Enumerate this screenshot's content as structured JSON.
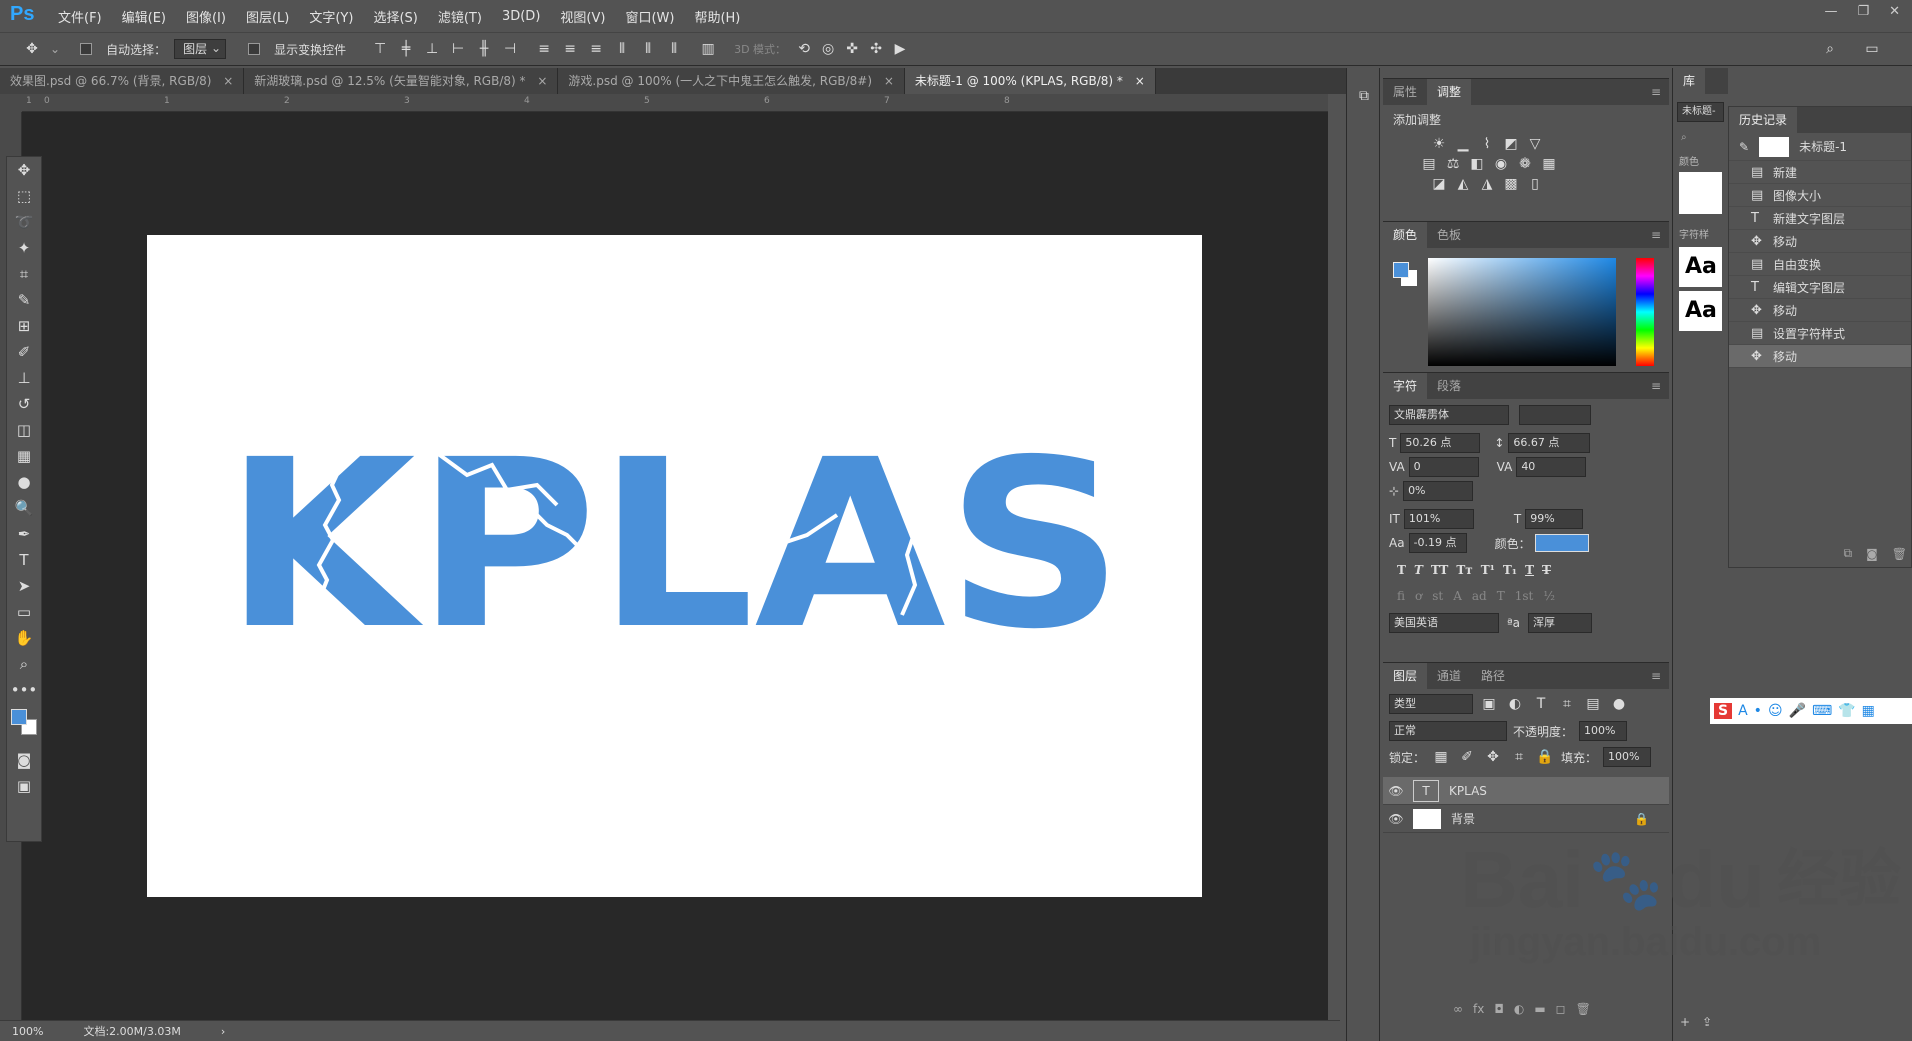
{
  "app": {
    "logo": "Ps"
  },
  "menu": [
    "文件(F)",
    "编辑(E)",
    "图像(I)",
    "图层(L)",
    "文字(Y)",
    "选择(S)",
    "滤镜(T)",
    "3D(D)",
    "视图(V)",
    "窗口(W)",
    "帮助(H)"
  ],
  "options": {
    "auto_select": "自动选择：",
    "layer_dd": "图层",
    "show_transform": "显示变换控件",
    "mode3d": "3D 模式："
  },
  "tabs": [
    "效果图.psd @ 66.7% (背景, RGB/8)",
    "新湖玻璃.psd @ 12.5% (矢量智能对象, RGB/8) *",
    "游戏.psd @ 100% (一人之下中鬼王怎么触发, RGB/8#)",
    "未标题-1 @ 100% (KPLAS, RGB/8) *"
  ],
  "ruler": [
    "1",
    "0",
    "1",
    "2",
    "3",
    "4",
    "5",
    "6",
    "7",
    "8"
  ],
  "canvas_text": "KPLAS",
  "text_color": "#4a90d9",
  "status": {
    "zoom": "100%",
    "doc": "文档:2.00M/3.03M"
  },
  "adjust": {
    "tab1": "属性",
    "tab2": "调整",
    "title": "添加调整"
  },
  "color": {
    "tab1": "颜色",
    "tab2": "色板",
    "fg": "#4a90d9"
  },
  "char": {
    "tab1": "字符",
    "tab2": "段落",
    "font": "文鼎霹雳体",
    "size": "50.26 点",
    "leading": "66.67 点",
    "kerning": "0",
    "tracking": "40",
    "scale": "0%",
    "vscale": "101%",
    "hscale": "99%",
    "baseline": "-0.19 点",
    "color_label": "颜色：",
    "lang": "美国英语",
    "aa": "浑厚",
    "aa_label": "ªa"
  },
  "layers": {
    "tab1": "图层",
    "tab2": "通道",
    "tab3": "路径",
    "filter": "类型",
    "blend": "正常",
    "opacity_label": "不透明度：",
    "opacity": "100%",
    "lock_label": "锁定：",
    "fill_label": "填充：",
    "fill": "100%",
    "items": [
      {
        "name": "KPLAS"
      },
      {
        "name": "背景"
      }
    ]
  },
  "lib": {
    "tab": "库",
    "untitled": "未标题-",
    "color_label": "颜色",
    "char_label": "字符样",
    "aa": "Aa"
  },
  "history": {
    "tab": "历史记录",
    "snapshot": "未标题-1",
    "items": [
      "新建",
      "图像大小",
      "新建文字图层",
      "移动",
      "自由变换",
      "编辑文字图层",
      "移动",
      "设置字符样式",
      "移动"
    ]
  },
  "watermark": {
    "brand": "Bai",
    "brand2": "du",
    "cn": "经验",
    "url": "jingyan.baidu.com"
  }
}
